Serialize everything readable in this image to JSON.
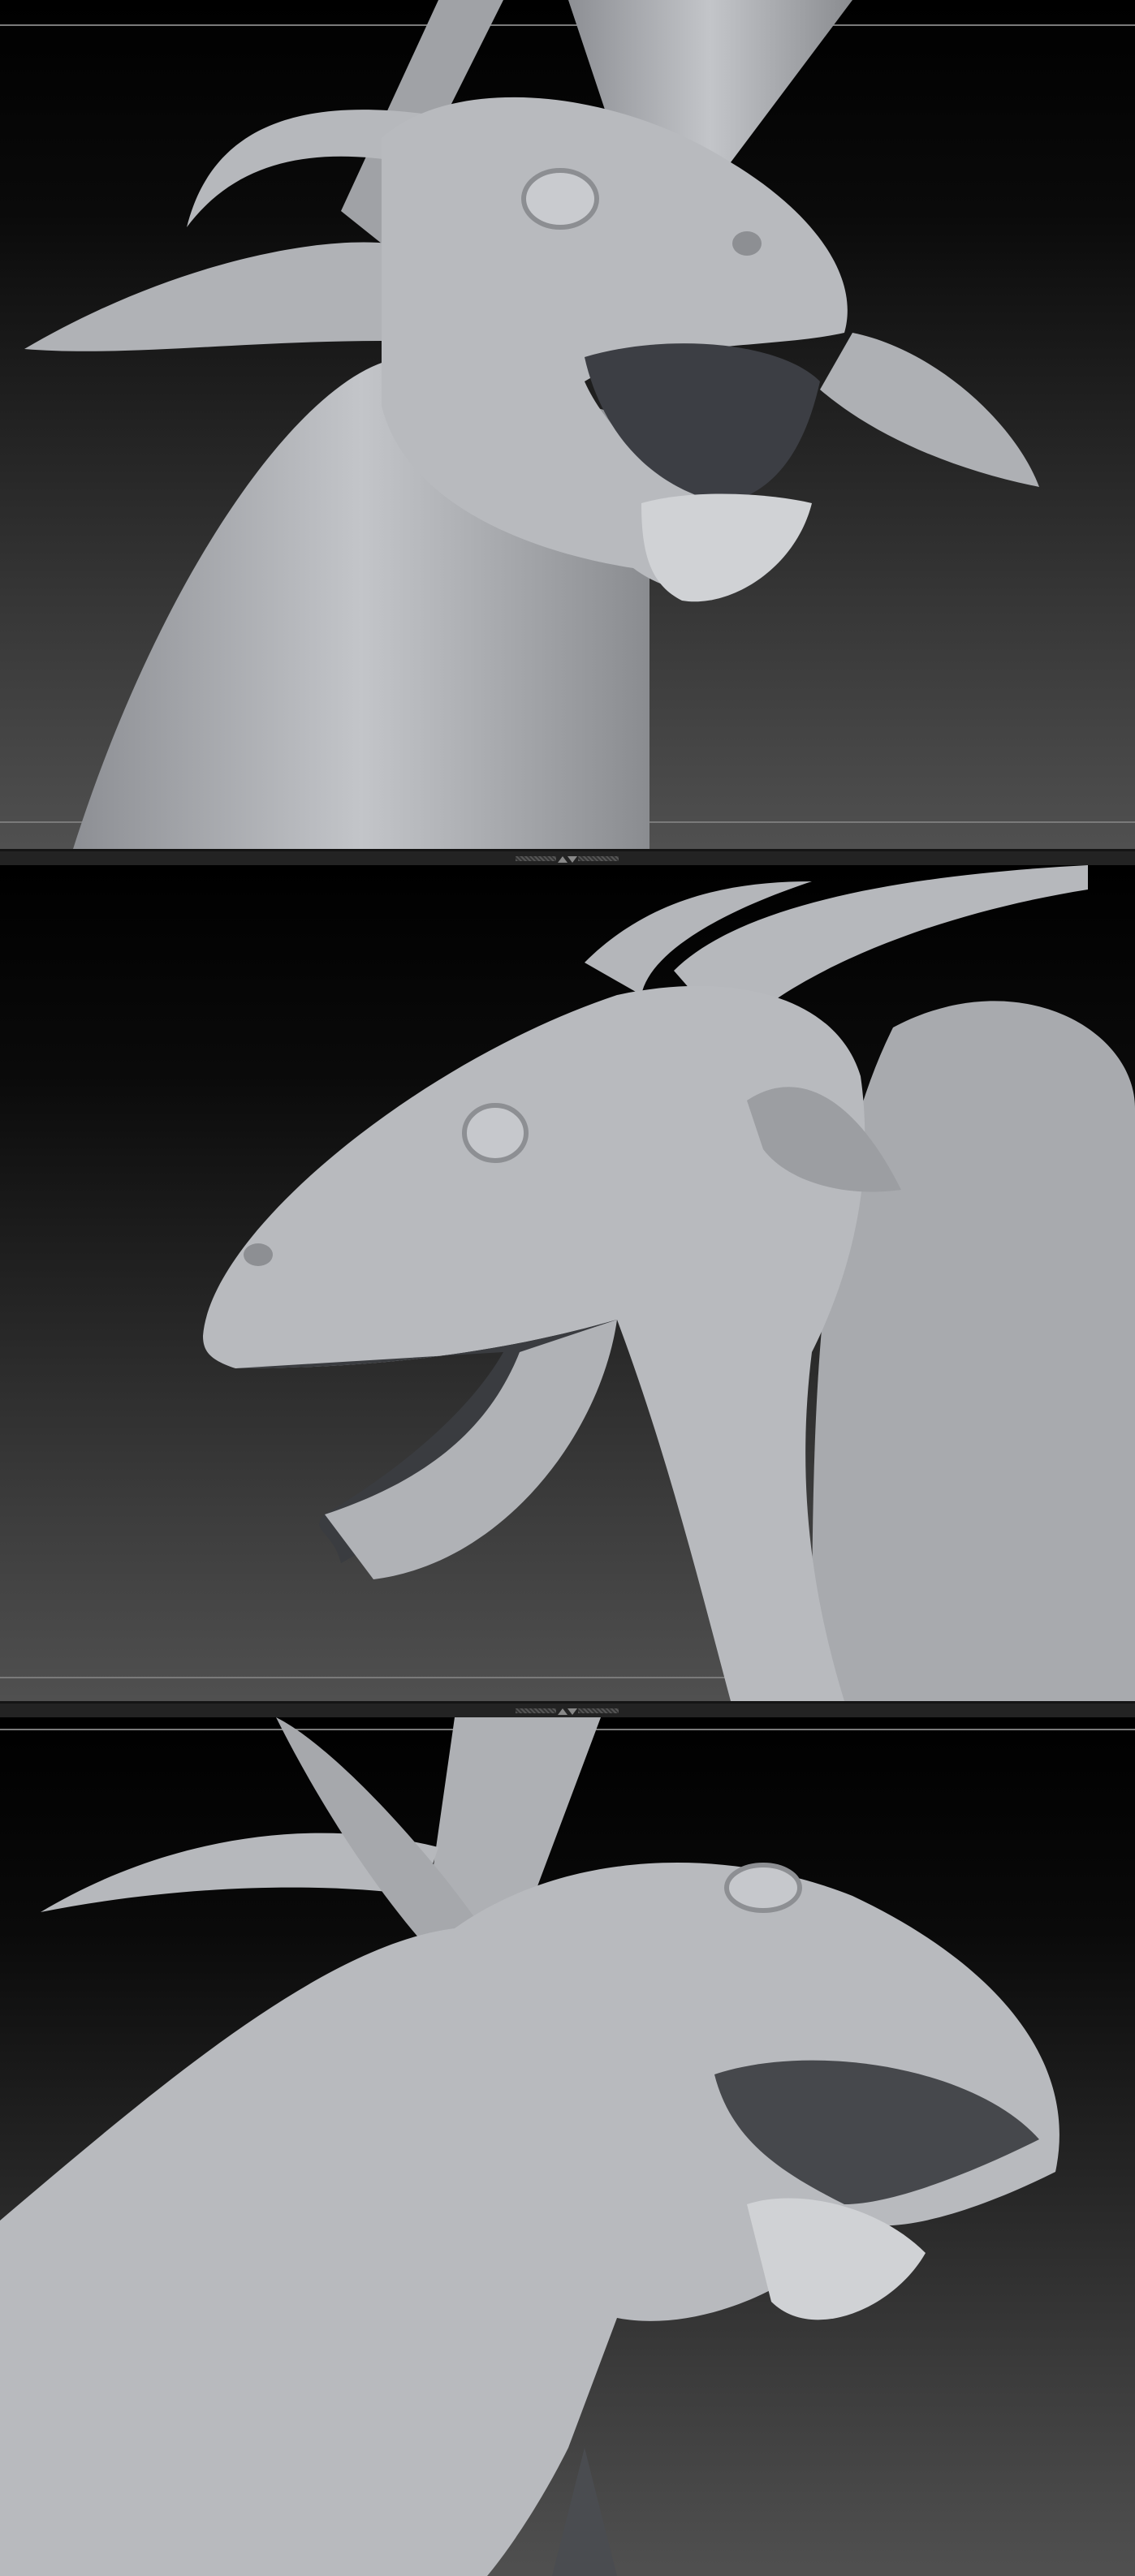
{
  "viewports": [
    {
      "view": "front-three-quarter"
    },
    {
      "view": "side"
    },
    {
      "view": "low-three-quarter"
    }
  ],
  "colors": {
    "sculpt": "#b4b6ba",
    "background_top": "#000000",
    "background_bottom": "#505050",
    "guide": "#7a7a7a"
  }
}
